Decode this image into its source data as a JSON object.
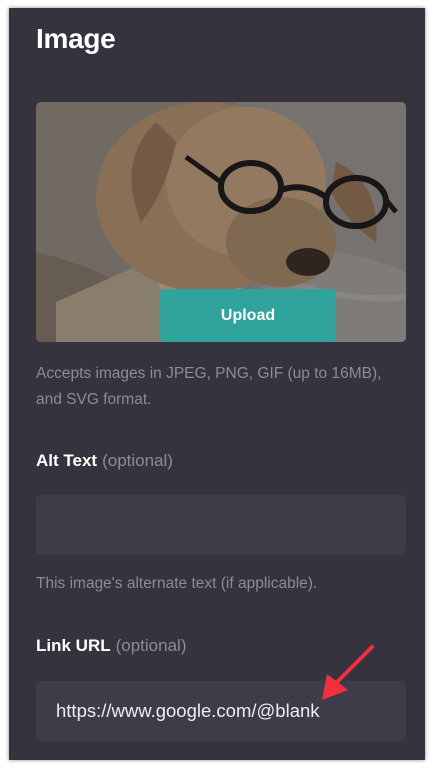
{
  "panel": {
    "title": "Image"
  },
  "image_preview": {
    "upload_label": "Upload"
  },
  "help": {
    "formats": "Accepts images in JPEG, PNG, GIF (up to 16MB), and SVG format.",
    "alt": "This image's alternate text (if applicable)."
  },
  "alt_text": {
    "label": "Alt Text",
    "optional": "(optional)",
    "value": ""
  },
  "link_url": {
    "label": "Link URL",
    "optional": "(optional)",
    "value": "https://www.google.com/@blank"
  },
  "colors": {
    "panel_background": "#34333e",
    "input_background": "#3d3c48",
    "accent": "#2fa39c",
    "annotation_arrow": "#f0303a"
  },
  "icons": {
    "annotation": "red-arrow-icon"
  }
}
